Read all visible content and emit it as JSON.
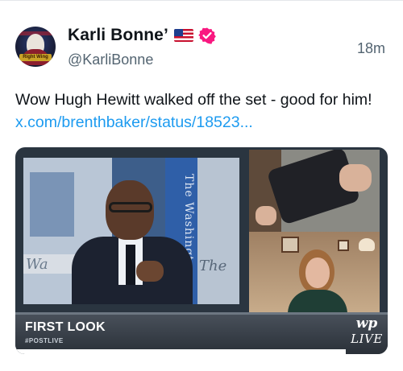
{
  "post": {
    "author": {
      "display_name": "Karli Bonne’",
      "handle": "@KarliBonne",
      "avatar_badge_text": "Right Wing",
      "flag_icon": "us-flag-icon",
      "verified_icon": "verified-badge-icon",
      "verified_color": "#f91880"
    },
    "timestamp": "18m",
    "text_prefix": "Wow Hugh Hewitt walked off the set - good for him! ",
    "link_text": "x.com/brenthbaker/status/18523...",
    "link_color": "#1d9bf0"
  },
  "video": {
    "lower_third_title": "FIRST LOOK",
    "lower_third_sub": "#POSTLIVE",
    "logo_mark": "wp",
    "logo_live": "LIVE",
    "background_wordmark": "The Washington",
    "left_wall_text": "Wa",
    "right_wall_text": "The"
  }
}
